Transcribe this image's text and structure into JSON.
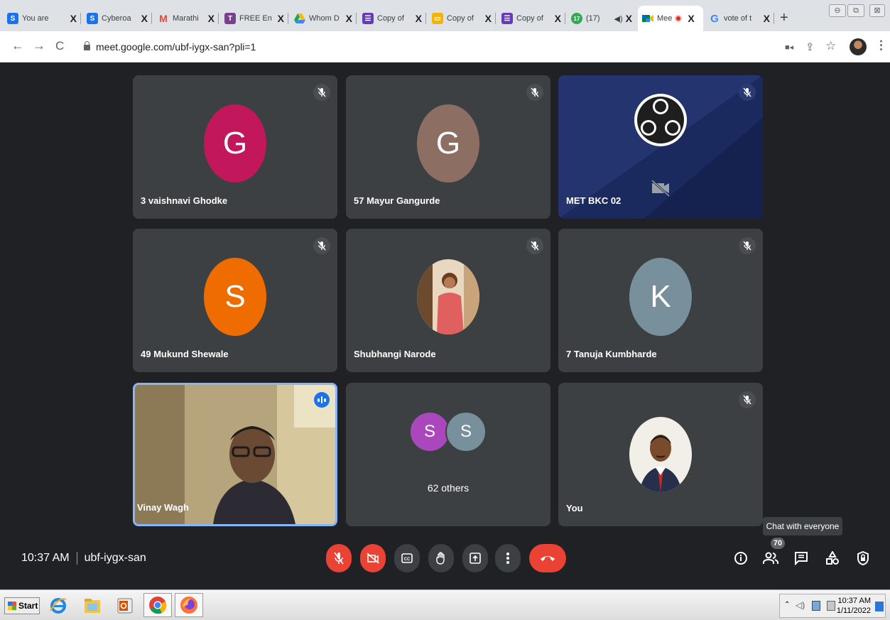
{
  "browser": {
    "tabs": [
      {
        "title": "You are",
        "favicon": "S",
        "color": "#1a73e8"
      },
      {
        "title": "Cyberoa",
        "favicon": "S",
        "color": "#1a73e8"
      },
      {
        "title": "Marathi",
        "favicon": "M",
        "color": "#ea4335"
      },
      {
        "title": "FREE En",
        "favicon": "T",
        "color": "#7b3f8f"
      },
      {
        "title": "Whom D",
        "favicon": "drive",
        "color": "#fbbc04"
      },
      {
        "title": "Copy of",
        "favicon": "forms",
        "color": "#673ab7"
      },
      {
        "title": "Copy of",
        "favicon": "slides",
        "color": "#f4b400"
      },
      {
        "title": "Copy of",
        "favicon": "forms",
        "color": "#673ab7"
      },
      {
        "title": "(17)",
        "favicon": "17",
        "color": "#34a853"
      },
      {
        "title": "Mee",
        "favicon": "meet",
        "color": "#00832d"
      },
      {
        "title": "vote of t",
        "favicon": "G",
        "color": "#4285f4"
      }
    ],
    "close_glyph": "X",
    "url": "meet.google.com/ubf-iygx-san?pli=1"
  },
  "meet": {
    "tiles": [
      {
        "name": "3 vaishnavi Ghodke",
        "initial": "G",
        "color": "#c2185b",
        "muted": true
      },
      {
        "name": "57 Mayur Gangurde",
        "initial": "G",
        "color": "#8d6e63",
        "muted": true
      },
      {
        "name": "MET BKC 02",
        "initial": "",
        "color": "#1b2a5e",
        "muted": true
      },
      {
        "name": "49 Mukund Shewale",
        "initial": "S",
        "color": "#ef6c00",
        "muted": true
      },
      {
        "name": "Shubhangi Narode",
        "initial": "",
        "color": "#e57373",
        "muted": true
      },
      {
        "name": "7 Tanuja Kumbharde",
        "initial": "K",
        "color": "#78909c",
        "muted": true
      },
      {
        "name": "Vinay Wagh",
        "initial": "",
        "color": "#1a73e8",
        "muted": false
      },
      {
        "name": "",
        "initial": "",
        "color": "#3c4043",
        "muted": false
      },
      {
        "name": "You",
        "initial": "",
        "color": "#3c4043",
        "muted": true
      }
    ],
    "others": {
      "label": "62 others",
      "avatars": [
        {
          "initial": "S",
          "color": "#ab47bc"
        },
        {
          "initial": "S",
          "color": "#78909c"
        }
      ]
    },
    "time": "10:37 AM",
    "meeting_code": "ubf-iygx-san",
    "tooltip": "Chat with everyone",
    "participant_count": "70"
  },
  "taskbar": {
    "start_label": "Start",
    "clock_time": "10:37 AM",
    "clock_date": "1/11/2022"
  }
}
